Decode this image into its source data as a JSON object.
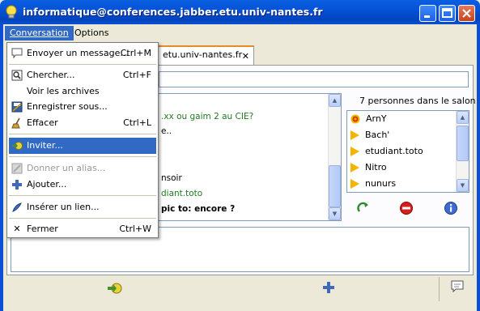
{
  "window": {
    "title": "informatique@conferences.jabber.etu.univ-nantes.fr"
  },
  "menubar": {
    "conversation": "Conversation",
    "options": "Options"
  },
  "tab": {
    "label": "etu.univ-nantes.fr"
  },
  "chat": {
    "lines": [
      ".xx ou gaim 2 au CIE?",
      "e..",
      "nsoir",
      "diant.toto",
      "pic to: encore ?"
    ]
  },
  "roster": {
    "title": "7 personnes dans le salon",
    "members": [
      "ArnY",
      "Bach'",
      "etudiant.toto",
      "Nitro",
      "nunurs"
    ]
  },
  "menu": {
    "items": [
      {
        "label": "Envoyer un message...",
        "shortcut": "Ctrl+M"
      },
      {
        "label": "Chercher...",
        "shortcut": "Ctrl+F"
      },
      {
        "label": "Voir les archives",
        "shortcut": ""
      },
      {
        "label": "Enregistrer sous...",
        "shortcut": ""
      },
      {
        "label": "Effacer",
        "shortcut": "Ctrl+L"
      },
      {
        "label": "Inviter...",
        "shortcut": ""
      },
      {
        "label": "Donner un alias...",
        "shortcut": ""
      },
      {
        "label": "Ajouter...",
        "shortcut": ""
      },
      {
        "label": "Insérer un lien...",
        "shortcut": ""
      },
      {
        "label": "Fermer",
        "shortcut": "Ctrl+W"
      }
    ]
  },
  "colors": {
    "titlebar": "#0653d6",
    "selection": "#316ac5",
    "tab_accent": "#e68b2c"
  }
}
